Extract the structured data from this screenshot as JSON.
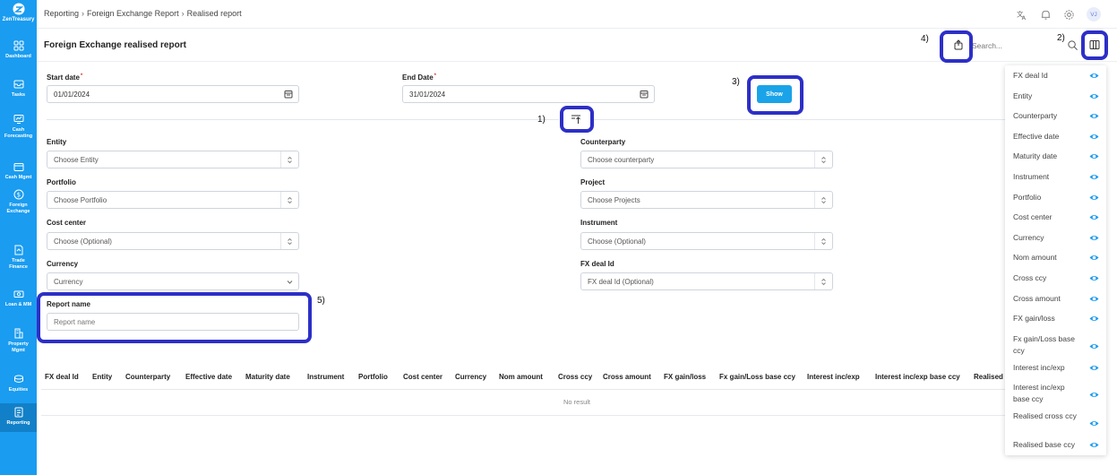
{
  "app": {
    "logo_text": "ZenTreasury"
  },
  "sidebar": {
    "items": [
      {
        "label": "Dashboard",
        "icon": "grid-icon"
      },
      {
        "label": "Tasks",
        "icon": "inbox-icon"
      },
      {
        "label": "Cash\nForecasting",
        "icon": "chart-monitor-icon"
      },
      {
        "label": "Cash Mgmt",
        "icon": "wallet-icon"
      },
      {
        "label": "Foreign\nExchange",
        "icon": "dollar-icon"
      },
      {
        "label": "Trade\nFinance",
        "icon": "document-icon"
      },
      {
        "label": "Loan & MM",
        "icon": "money-icon"
      },
      {
        "label": "Property\nMgmt",
        "icon": "building-icon"
      },
      {
        "label": "Equities",
        "icon": "coins-icon"
      },
      {
        "label": "Reporting",
        "icon": "report-icon"
      }
    ],
    "active": "Reporting"
  },
  "breadcrumb": [
    "Reporting",
    "Foreign Exchange Report",
    "Realised report"
  ],
  "topbar": {
    "avatar_initials": "VJ"
  },
  "page": {
    "title": "Foreign Exchange realised report",
    "search_placeholder": "Search..."
  },
  "form": {
    "start_date_label": "Start date",
    "start_date_value": "01/01/2024",
    "end_date_label": "End Date",
    "end_date_value": "31/01/2024",
    "show_label": "Show",
    "entity_label": "Entity",
    "entity_placeholder": "Choose Entity",
    "counterparty_label": "Counterparty",
    "counterparty_placeholder": "Choose counterparty",
    "portfolio_label": "Portfolio",
    "portfolio_placeholder": "Choose Portfolio",
    "project_label": "Project",
    "project_placeholder": "Choose Projects",
    "cost_center_label": "Cost center",
    "cost_center_placeholder": "Choose (Optional)",
    "instrument_label": "Instrument",
    "instrument_placeholder": "Choose (Optional)",
    "currency_label": "Currency",
    "currency_placeholder": "Currency",
    "fx_deal_label": "FX deal Id",
    "fx_deal_placeholder": "FX deal Id (Optional)",
    "report_name_label": "Report name",
    "report_name_placeholder": "Report name"
  },
  "annotations": [
    "1)",
    "2)",
    "3)",
    "4)",
    "5)"
  ],
  "table": {
    "columns": [
      "FX deal Id",
      "Entity",
      "Counterparty",
      "Effective date",
      "Maturity date",
      "Instrument",
      "Portfolio",
      "Cost center",
      "Currency",
      "Nom amount",
      "Cross ccy",
      "Cross amount",
      "FX gain/loss",
      "Fx gain/Loss base ccy",
      "Interest inc/exp",
      "Interest inc/exp base ccy",
      "Realised c"
    ],
    "empty_text": "No result"
  },
  "column_panel": {
    "items": [
      "FX deal Id",
      "Entity",
      "Counterparty",
      "Effective date",
      "Maturity date",
      "Instrument",
      "Portfolio",
      "Cost center",
      "Currency",
      "Nom amount",
      "Cross ccy",
      "Cross amount",
      "FX gain/loss",
      "Fx gain/Loss base ccy",
      "Interest inc/exp",
      "Interest inc/exp base ccy",
      "Realised cross ccy",
      "Realised base ccy"
    ]
  },
  "colors": {
    "sidebar": "#1a9cf0",
    "primary_button": "#1aa3e8",
    "highlight": "#2d2fc7",
    "eye_icon": "#1a9cf0"
  }
}
